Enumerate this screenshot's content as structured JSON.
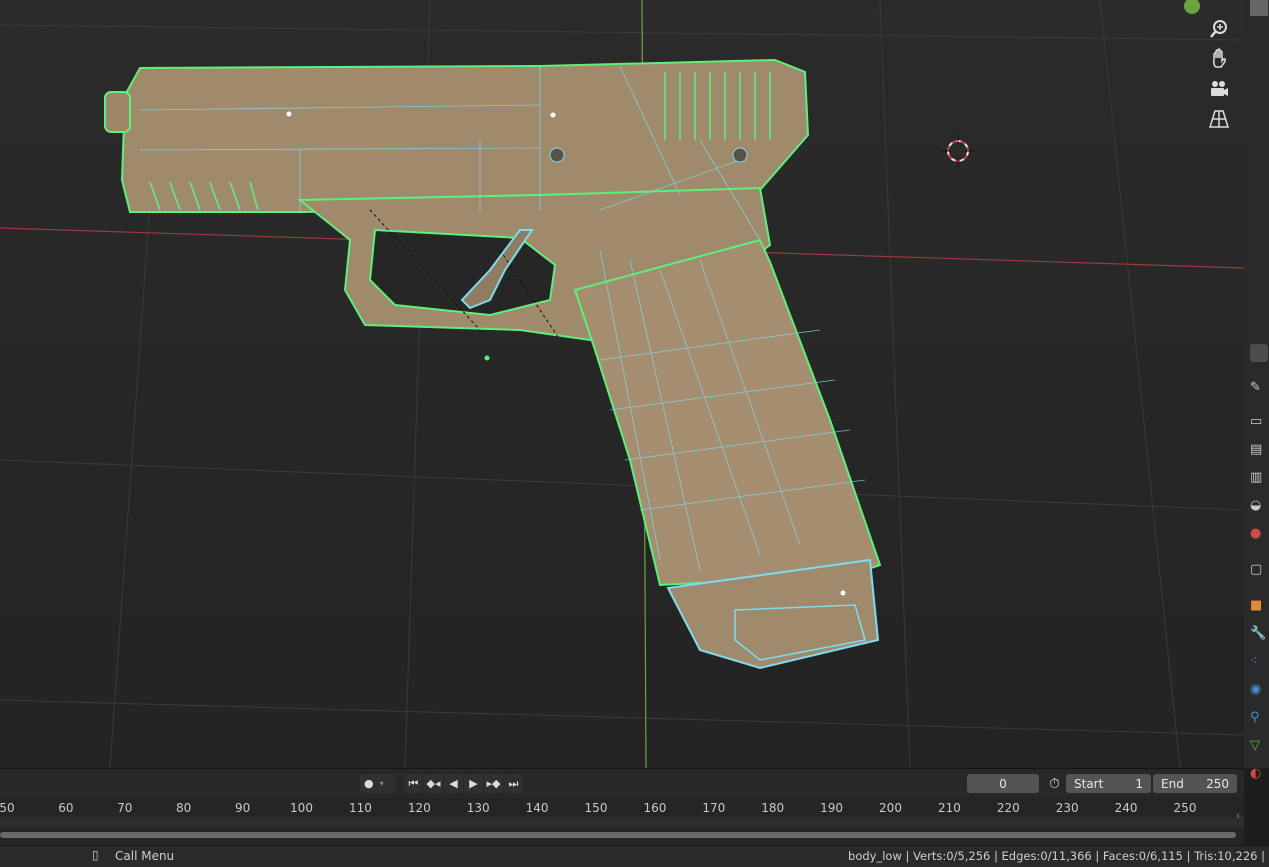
{
  "timeline": {
    "current_frame": "0",
    "start_label": "Start",
    "start_value": "1",
    "end_label": "End",
    "end_value": "250"
  },
  "ruler": {
    "ticks": [
      "50",
      "60",
      "70",
      "80",
      "90",
      "100",
      "110",
      "120",
      "130",
      "140",
      "150",
      "160",
      "170",
      "180",
      "190",
      "200",
      "210",
      "220",
      "230",
      "240",
      "250"
    ]
  },
  "statusbar": {
    "call_menu": "Call Menu",
    "stats": "body_low | Verts:0/5,256 | Edges:0/11,366 | Faces:0/6,115 | Tris:10,226 |"
  },
  "colors": {
    "mesh_fill": "#a08a6c",
    "selection_edge": "#5df07a",
    "wire": "#7fdcf0",
    "x_axis": "#9a3b3b",
    "y_axis": "#6ba43a"
  },
  "icons": [
    "zoom-icon",
    "hand-pan-icon",
    "camera-icon",
    "perspective-grid-icon",
    "record-icon",
    "jump-start-icon",
    "prev-keyframe-icon",
    "play-reverse-icon",
    "play-icon",
    "next-keyframe-icon",
    "jump-end-icon",
    "stopwatch-icon",
    "mouse-icon"
  ]
}
